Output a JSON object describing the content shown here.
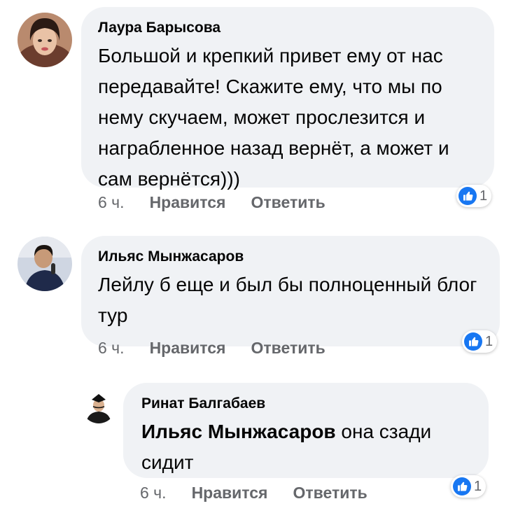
{
  "comments": [
    {
      "author": "Лаура Барысова",
      "text": "Большой и крепкий привет ему от нас передавайте! Скажите ему, что мы по нему скучаем, может прослезится и награбленное назад вернёт, а может и сам вернётся)))",
      "time": "6 ч.",
      "like_label": "Нравится",
      "reply_label": "Ответить",
      "reaction_count": "1"
    },
    {
      "author": "Ильяс Мынжасаров",
      "text": "Лейлу б еще и был бы полноценный блог тур",
      "time": "6 ч.",
      "like_label": "Нравится",
      "reply_label": "Ответить",
      "reaction_count": "1"
    },
    {
      "author": "Ринат Балгабаев",
      "mention": "Ильяс Мынжасаров",
      "text": " она сзади сидит",
      "time": "6 ч.",
      "like_label": "Нравится",
      "reply_label": "Ответить",
      "reaction_count": "1"
    }
  ],
  "colors": {
    "bubble": "#f0f2f5",
    "like_blue": "#1877f2",
    "meta_gray": "#65676b"
  },
  "icons": [
    "like-icon"
  ]
}
